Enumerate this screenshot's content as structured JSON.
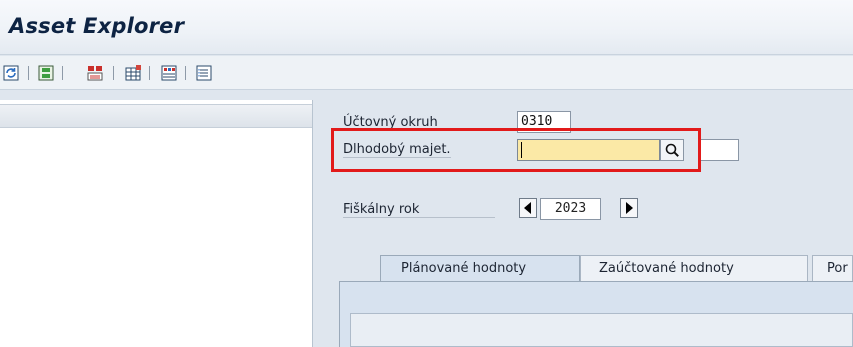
{
  "window": {
    "title": "Asset Explorer"
  },
  "toolbar": {
    "icons": [
      "refresh-icon",
      "save-layout-icon",
      "asset-values-icon",
      "table-icon",
      "grid-icon",
      "list-icon"
    ]
  },
  "form": {
    "company_code_label": "Účtovný okruh",
    "company_code_value": "0310",
    "asset_label": "Dlhodobý majet.",
    "asset_value": "",
    "subnumber_value": "",
    "fiscal_year_label": "Fiškálny rok",
    "fiscal_year_value": "2023"
  },
  "tabs": [
    {
      "label": "Plánované hodnoty",
      "active": true
    },
    {
      "label": "Zaúčtované hodnoty",
      "active": false
    },
    {
      "label": "Por",
      "active": false
    }
  ],
  "colors": {
    "highlight": "#e21a1a",
    "required_field": "#fbe9a6"
  }
}
